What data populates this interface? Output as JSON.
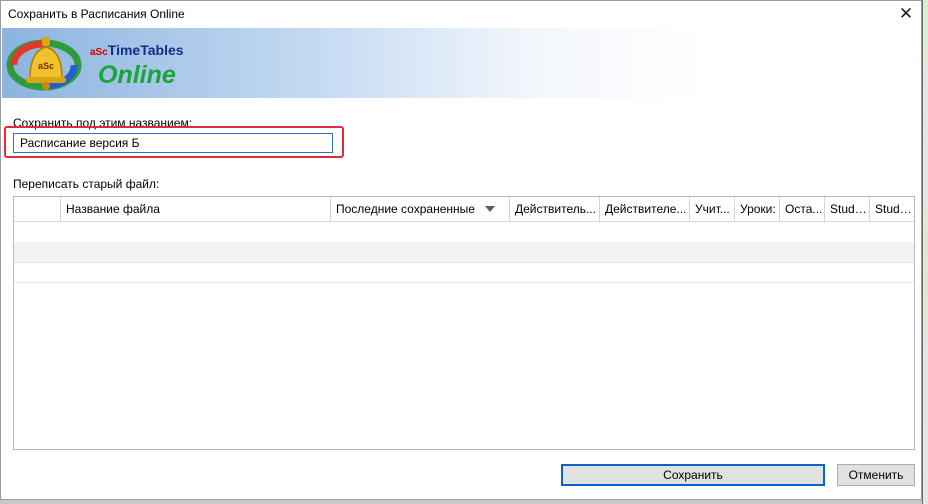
{
  "window": {
    "title": "Сохранить в Расписания Online",
    "close_glyph": "✕"
  },
  "banner": {
    "brand_prefix": "aSc",
    "brand_name": "TimeTables",
    "subtitle": "Online",
    "logo_badge": "aSc"
  },
  "form": {
    "save_label": "Сохранить под этим названием:",
    "name_value": "Расписание версия Б",
    "overwrite_label": "Переписать старый файл:"
  },
  "table": {
    "columns": [
      "",
      "Название файла",
      "Последние сохраненные",
      "Действитель...",
      "Действителе...",
      "Учит...",
      "Уроки:",
      "Оста...",
      "Stude...",
      "Stude..."
    ],
    "sorted_column_icon": "sort-down-icon",
    "rows": []
  },
  "buttons": {
    "save": "Сохранить",
    "cancel": "Отменить"
  },
  "colors": {
    "highlight": "#e02b3a",
    "input_border": "#2c6fc5",
    "online_green": "#1ca33a",
    "brand_blue": "#0e2f8a"
  }
}
